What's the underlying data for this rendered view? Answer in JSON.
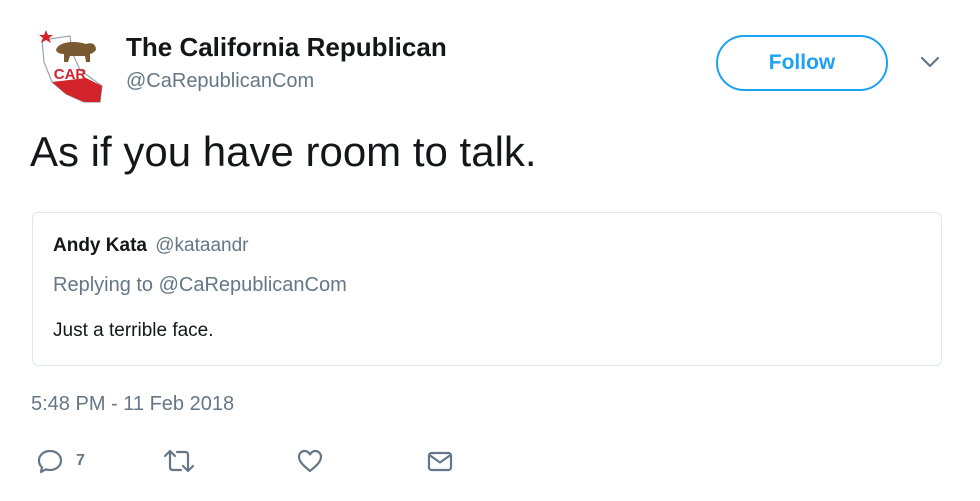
{
  "author": {
    "display_name": "The California Republican",
    "handle": "@CaRepublicanCom",
    "avatar_text": "CAR"
  },
  "follow_button": {
    "label": "Follow"
  },
  "tweet": {
    "text": "As if you have room to talk.",
    "timestamp": "5:48 PM - 11 Feb 2018"
  },
  "quoted_tweet": {
    "author_name": "Andy Kata",
    "author_handle": "@kataandr",
    "replying_to": "Replying to @CaRepublicanCom",
    "text": "Just a terrible face."
  },
  "actions": {
    "reply_count": "7",
    "icons": [
      "reply-icon",
      "retweet-icon",
      "like-icon",
      "direct-message-icon"
    ]
  },
  "colors": {
    "accent": "#1da1f2",
    "secondary_text": "#657786",
    "primary_text": "#14171a",
    "border": "#e1e8ed",
    "logo_red": "#d2232a",
    "logo_brown": "#7a5a32"
  }
}
